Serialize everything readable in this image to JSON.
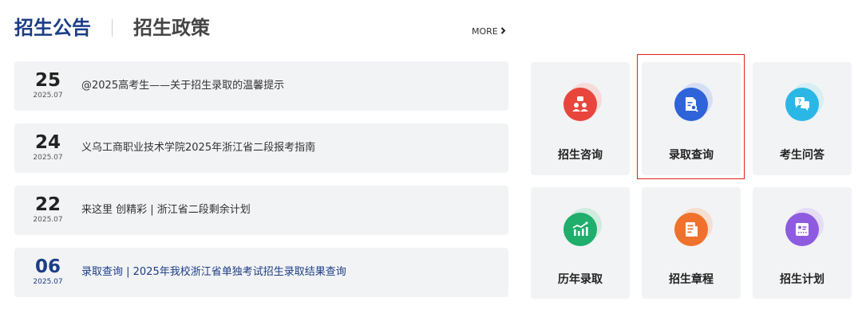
{
  "tabs": [
    {
      "label": "招生公告",
      "active": true
    },
    {
      "label": "招生政策",
      "active": false
    }
  ],
  "more_label": "MORE",
  "news": [
    {
      "day": "25",
      "month": "2025.07",
      "title": "@2025高考生——关于招生录取的温馨提示",
      "highlight": false
    },
    {
      "day": "24",
      "month": "2025.07",
      "title": "义乌工商职业技术学院2025年浙江省二段报考指南",
      "highlight": false
    },
    {
      "day": "22",
      "month": "2025.07",
      "title": "来这里 创精彩 | 浙江省二段剩余计划",
      "highlight": false
    },
    {
      "day": "06",
      "month": "2025.07",
      "title": "录取查询 | 2025年我校浙江省单独考试招生录取结果查询",
      "highlight": true
    }
  ],
  "tiles": [
    {
      "label": "招生咨询",
      "icon": "consult-icon",
      "color": "#e8453c",
      "selected": false
    },
    {
      "label": "录取查询",
      "icon": "admission-query-icon",
      "color": "#2f63d9",
      "selected": true
    },
    {
      "label": "考生问答",
      "icon": "qa-icon",
      "color": "#2bb7e6",
      "selected": false
    },
    {
      "label": "历年录取",
      "icon": "history-chart-icon",
      "color": "#1fae6b",
      "selected": false
    },
    {
      "label": "招生章程",
      "icon": "charter-document-icon",
      "color": "#f0712c",
      "selected": false
    },
    {
      "label": "招生计划",
      "icon": "plan-card-icon",
      "color": "#8e5be0",
      "selected": false
    }
  ]
}
